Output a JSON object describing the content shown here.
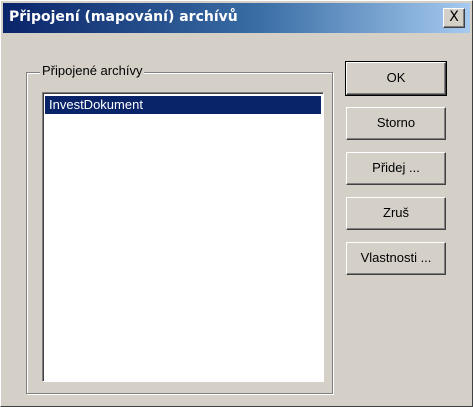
{
  "window": {
    "title": "Připojení (mapování) archívů",
    "close_symbol": "X"
  },
  "group": {
    "label": "Připojené archívy"
  },
  "list": {
    "items": [
      {
        "label": "InvestDokument",
        "selected": true
      }
    ]
  },
  "buttons": {
    "ok": "OK",
    "storno": "Storno",
    "pridej": "Přidej ...",
    "zrus": "Zruš",
    "vlastnosti": "Vlastnosti ..."
  },
  "colors": {
    "titlebar_start": "#0a246a",
    "titlebar_end": "#a6caf0",
    "dialog_background": "#d4d0c8",
    "selection_background": "#0a246a",
    "selection_text": "#ffffff"
  }
}
